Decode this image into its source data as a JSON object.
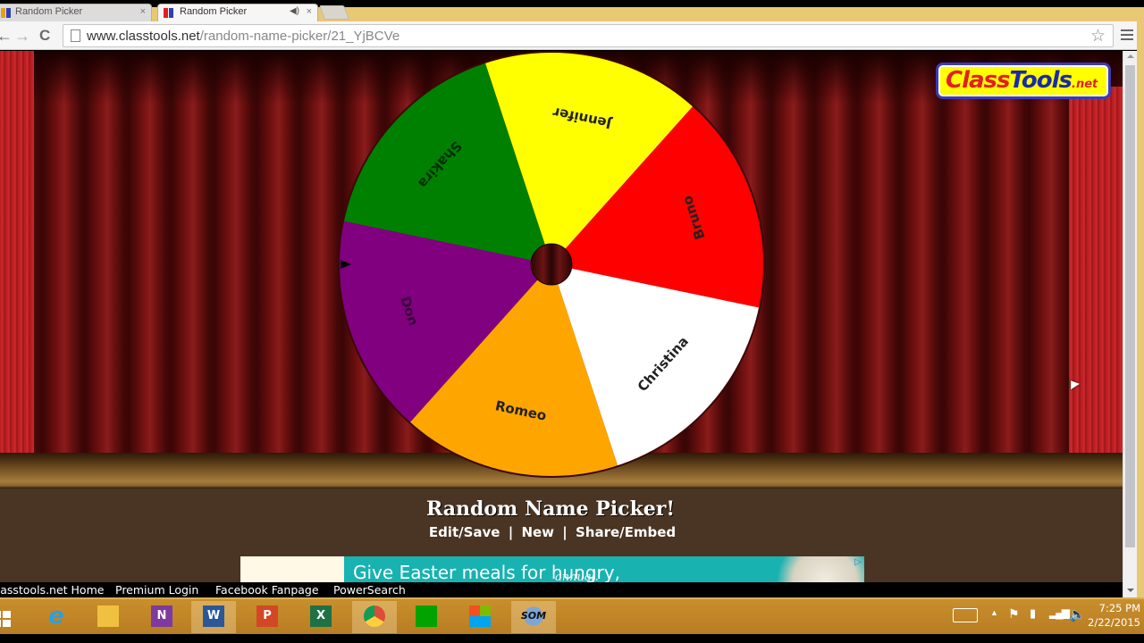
{
  "browser": {
    "tabs": [
      {
        "label": "Random Picker",
        "active": false
      },
      {
        "label": "Random Picker",
        "active": true,
        "audio": true
      }
    ],
    "url_host": "www.classtools.net",
    "url_path": "/random-name-picker/21_YjBCVe",
    "icons": {
      "back": "←",
      "forward": "→",
      "reload": "C",
      "star": "☆",
      "close": "×",
      "audio": "◀)"
    }
  },
  "page": {
    "logo": {
      "class": "Class",
      "tools": "Tools",
      "net": ".net"
    },
    "wheel": {
      "rotation_offset_deg": -108.2,
      "segments": [
        {
          "name": "Jennifer",
          "color": "#ffff00"
        },
        {
          "name": "Bruno",
          "color": "#ff0000"
        },
        {
          "name": "Christina",
          "color": "#ffffff"
        },
        {
          "name": "Romeo",
          "color": "#ffa500"
        },
        {
          "name": "Don",
          "color": "#800080"
        },
        {
          "name": "Shakira",
          "color": "#008000"
        }
      ],
      "hub_color": "#4a0c0c",
      "pointer": "left"
    },
    "title": "Random Name Picker!",
    "links": [
      "Edit/Save",
      "New",
      "Share/Embed"
    ],
    "separator": "|",
    "ad": {
      "headline": "Give Easter meals for hungry,",
      "sub": "annual.",
      "choice_icon": "▷"
    },
    "footer_links": [
      "Classtools.net Home",
      "Premium Login",
      "Facebook Fanpage",
      "PowerSearch"
    ]
  },
  "taskbar": {
    "apps": [
      {
        "name": "internet-explorer",
        "label": "e",
        "color": "#2aa0e0"
      },
      {
        "name": "file-explorer",
        "label": "",
        "color": "#f0c040"
      },
      {
        "name": "onenote",
        "label": "N",
        "color": "#7e3a9c"
      },
      {
        "name": "word",
        "label": "W",
        "color": "#2b5797"
      },
      {
        "name": "powerpoint",
        "label": "P",
        "color": "#d24726"
      },
      {
        "name": "excel",
        "label": "X",
        "color": "#1e7145"
      },
      {
        "name": "chrome",
        "label": "",
        "color": "#dd4b39"
      },
      {
        "name": "store",
        "label": "",
        "color": "#00a300"
      },
      {
        "name": "office",
        "label": "",
        "color": "#f25022"
      },
      {
        "name": "som",
        "label": "SOM",
        "color": "#6f9fd0"
      }
    ],
    "time": "7:25 PM",
    "date": "2/22/2015"
  }
}
